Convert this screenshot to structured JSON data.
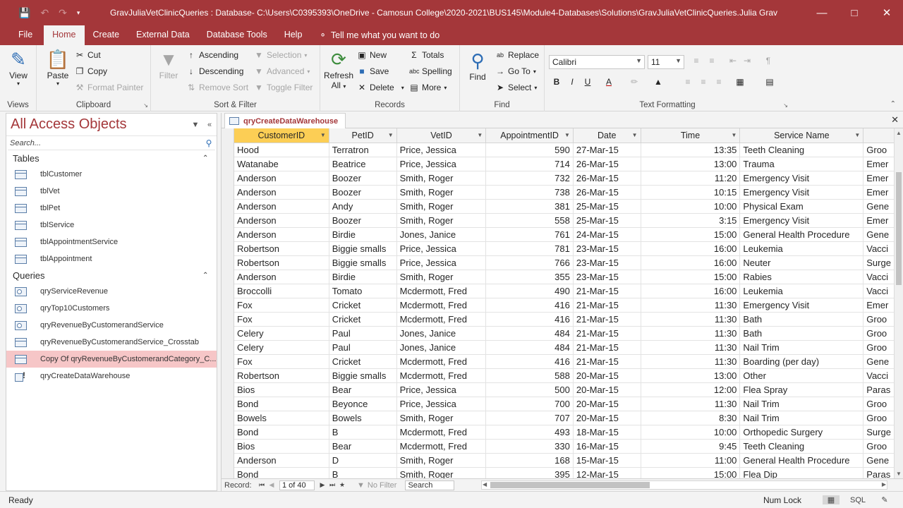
{
  "titlebar": {
    "title": "GravJuliaVetClinicQueries : Database- C:\\Users\\C0395393\\OneDrive - Camosun College\\2020-2021\\BUS145\\Module4-Databases\\Solutions\\GravJuliaVetClinicQueries.accdb...",
    "user": "Julia Grav"
  },
  "tabs": [
    "File",
    "Home",
    "Create",
    "External Data",
    "Database Tools",
    "Help"
  ],
  "tell_me": "Tell me what you want to do",
  "ribbon": {
    "views": {
      "view": "View",
      "label": "Views"
    },
    "clipboard": {
      "paste": "Paste",
      "cut": "Cut",
      "copy": "Copy",
      "format_painter": "Format Painter",
      "label": "Clipboard"
    },
    "sort_filter": {
      "filter": "Filter",
      "ascending": "Ascending",
      "descending": "Descending",
      "remove_sort": "Remove Sort",
      "selection": "Selection",
      "advanced": "Advanced",
      "toggle_filter": "Toggle Filter",
      "label": "Sort & Filter"
    },
    "records": {
      "refresh": "Refresh",
      "refresh_sub": "All",
      "new": "New",
      "save": "Save",
      "delete": "Delete",
      "totals": "Totals",
      "spelling": "Spelling",
      "more": "More",
      "label": "Records"
    },
    "find": {
      "find": "Find",
      "replace": "Replace",
      "goto": "Go To",
      "select": "Select",
      "label": "Find"
    },
    "text": {
      "font": "Calibri",
      "size": "11",
      "label": "Text Formatting"
    }
  },
  "nav": {
    "title": "All Access Objects",
    "search_placeholder": "Search...",
    "tables_label": "Tables",
    "tables": [
      "tblCustomer",
      "tblVet",
      "tblPet",
      "tblService",
      "tblAppointmentService",
      "tblAppointment"
    ],
    "queries_label": "Queries",
    "queries": [
      "qryServiceRevenue",
      "qryTop10Customers",
      "qryRevenueByCustomerandService",
      "qryRevenueByCustomerandService_Crosstab",
      "Copy Of qryRevenueByCustomerandCategory_C...",
      "qryCreateDataWarehouse"
    ]
  },
  "doc": {
    "tab_title": "qryCreateDataWarehouse",
    "columns": [
      "CustomerID",
      "PetID",
      "VetID",
      "AppointmentID",
      "Date",
      "Time",
      "Service Name",
      ""
    ],
    "rows": [
      [
        "Hood",
        "Terratron",
        "Price, Jessica",
        "590",
        "27-Mar-15",
        "13:35",
        "Teeth Cleaning",
        "Groo"
      ],
      [
        "Watanabe",
        "Beatrice",
        "Price, Jessica",
        "714",
        "26-Mar-15",
        "13:00",
        "Trauma",
        "Emer"
      ],
      [
        "Anderson",
        "Boozer",
        "Smith, Roger",
        "732",
        "26-Mar-15",
        "11:20",
        "Emergency Visit",
        "Emer"
      ],
      [
        "Anderson",
        "Boozer",
        "Smith, Roger",
        "738",
        "26-Mar-15",
        "10:15",
        "Emergency Visit",
        "Emer"
      ],
      [
        "Anderson",
        "Andy",
        "Smith, Roger",
        "381",
        "25-Mar-15",
        "10:00",
        "Physical Exam",
        "Gene"
      ],
      [
        "Anderson",
        "Boozer",
        "Smith, Roger",
        "558",
        "25-Mar-15",
        "3:15",
        "Emergency Visit",
        "Emer"
      ],
      [
        "Anderson",
        "Birdie",
        "Jones, Janice",
        "761",
        "24-Mar-15",
        "15:00",
        "General Health Procedure",
        "Gene"
      ],
      [
        "Robertson",
        "Biggie smalls",
        "Price, Jessica",
        "781",
        "23-Mar-15",
        "16:00",
        "Leukemia",
        "Vacci"
      ],
      [
        "Robertson",
        "Biggie smalls",
        "Price, Jessica",
        "766",
        "23-Mar-15",
        "16:00",
        "Neuter",
        "Surge"
      ],
      [
        "Anderson",
        "Birdie",
        "Smith, Roger",
        "355",
        "23-Mar-15",
        "15:00",
        "Rabies",
        "Vacci"
      ],
      [
        "Broccolli",
        "Tomato",
        "Mcdermott, Fred",
        "490",
        "21-Mar-15",
        "16:00",
        "Leukemia",
        "Vacci"
      ],
      [
        "Fox",
        "Cricket",
        "Mcdermott, Fred",
        "416",
        "21-Mar-15",
        "11:30",
        "Emergency Visit",
        "Emer"
      ],
      [
        "Fox",
        "Cricket",
        "Mcdermott, Fred",
        "416",
        "21-Mar-15",
        "11:30",
        "Bath",
        "Groo"
      ],
      [
        "Celery",
        "Paul",
        "Jones, Janice",
        "484",
        "21-Mar-15",
        "11:30",
        "Bath",
        "Groo"
      ],
      [
        "Celery",
        "Paul",
        "Jones, Janice",
        "484",
        "21-Mar-15",
        "11:30",
        "Nail Trim",
        "Groo"
      ],
      [
        "Fox",
        "Cricket",
        "Mcdermott, Fred",
        "416",
        "21-Mar-15",
        "11:30",
        "Boarding (per day)",
        "Gene"
      ],
      [
        "Robertson",
        "Biggie smalls",
        "Mcdermott, Fred",
        "588",
        "20-Mar-15",
        "13:00",
        "Other",
        "Vacci"
      ],
      [
        "Bios",
        "Bear",
        "Price, Jessica",
        "500",
        "20-Mar-15",
        "12:00",
        "Flea Spray",
        "Paras"
      ],
      [
        "Bond",
        "Beyonce",
        "Price, Jessica",
        "700",
        "20-Mar-15",
        "11:30",
        "Nail Trim",
        "Groo"
      ],
      [
        "Bowels",
        "Bowels",
        "Smith, Roger",
        "707",
        "20-Mar-15",
        "8:30",
        "Nail Trim",
        "Groo"
      ],
      [
        "Bond",
        "B",
        "Mcdermott, Fred",
        "493",
        "18-Mar-15",
        "10:00",
        "Orthopedic Surgery",
        "Surge"
      ],
      [
        "Bios",
        "Bear",
        "Mcdermott, Fred",
        "330",
        "16-Mar-15",
        "9:45",
        "Teeth Cleaning",
        "Groo"
      ],
      [
        "Anderson",
        "D",
        "Smith, Roger",
        "168",
        "15-Mar-15",
        "11:00",
        "General Health Procedure",
        "Gene"
      ],
      [
        "Bond",
        "B",
        "Smith, Roger",
        "395",
        "12-Mar-15",
        "15:00",
        "Flea Dip",
        "Paras"
      ]
    ],
    "record_label": "Record:",
    "record_position": "1 of 40",
    "no_filter": "No Filter",
    "search": "Search"
  },
  "status": {
    "left": "Ready",
    "num_lock": "Num Lock",
    "sql": "SQL"
  }
}
